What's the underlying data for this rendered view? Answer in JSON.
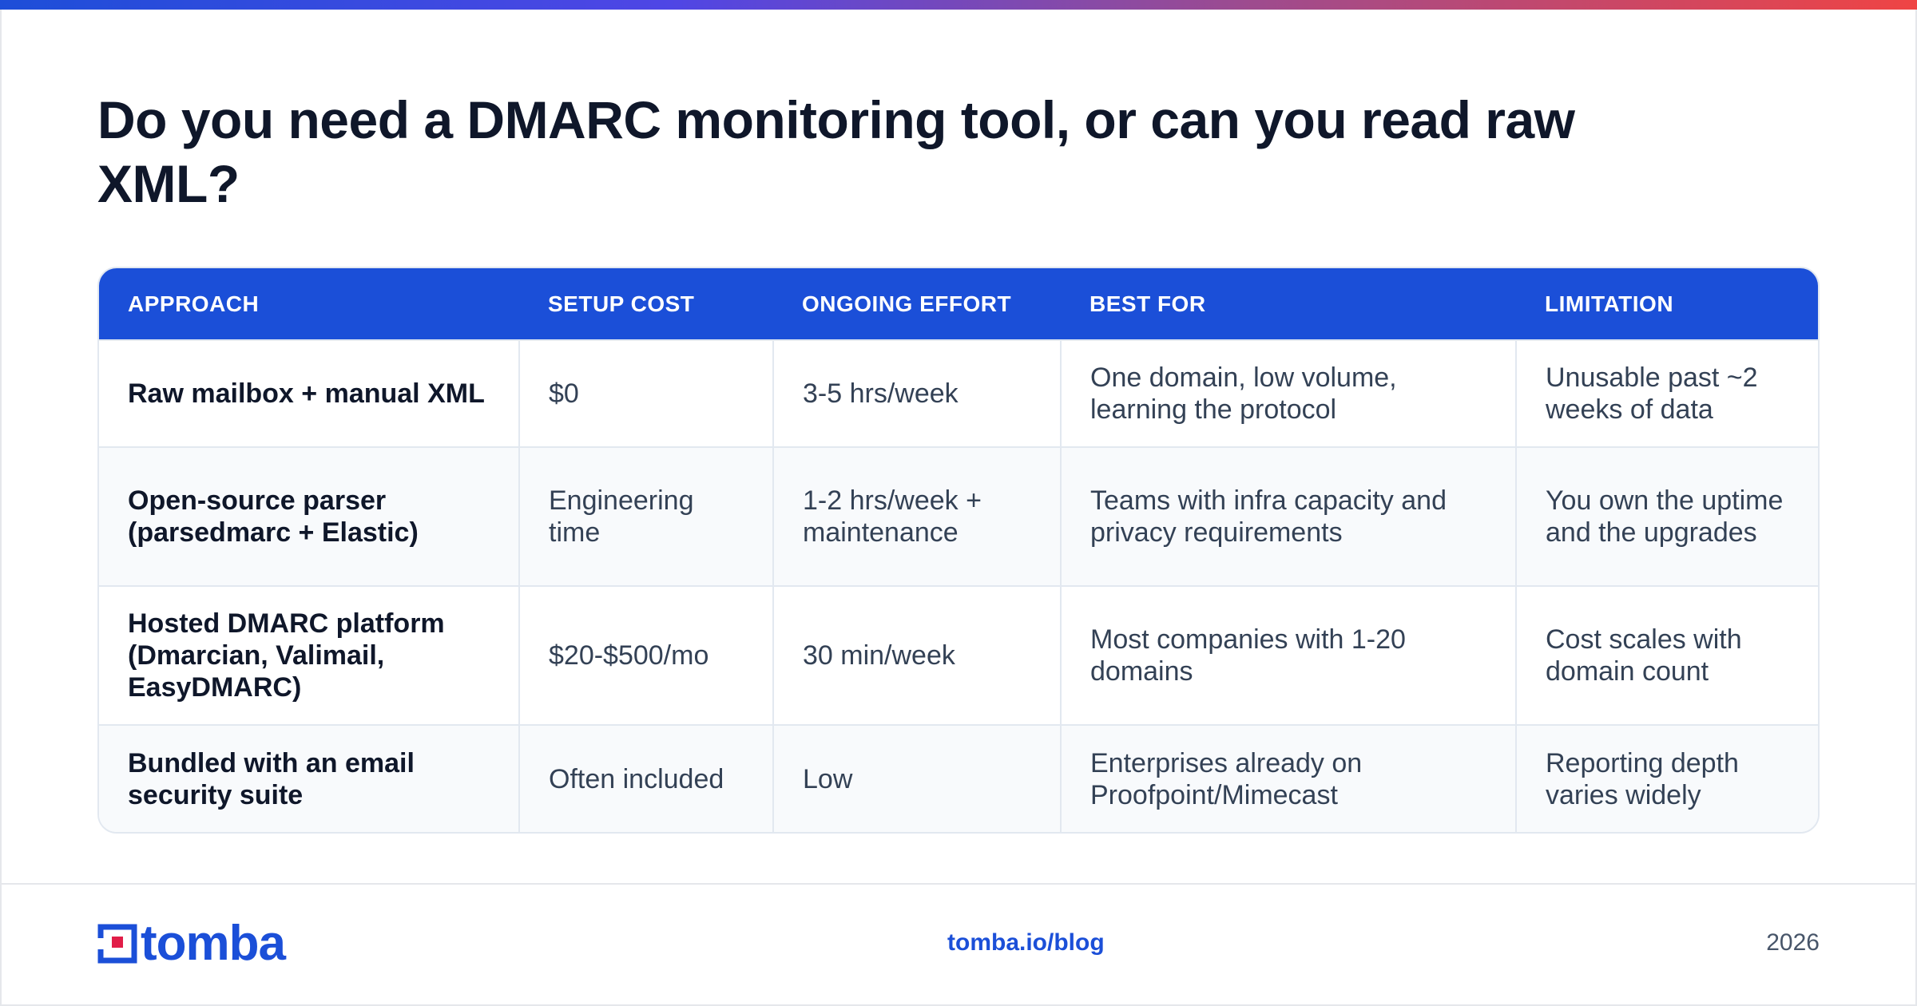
{
  "title": "Do you need a DMARC monitoring tool, or can you read raw XML?",
  "table": {
    "headers": [
      "APPROACH",
      "SETUP COST",
      "ONGOING EFFORT",
      "BEST FOR",
      "LIMITATION"
    ],
    "rows": [
      [
        "Raw mailbox + manual XML",
        "$0",
        "3-5 hrs/week",
        "One domain, low volume, learning the protocol",
        "Unusable past ~2 weeks of data"
      ],
      [
        "Open-source parser (parsedmarc + Elastic)",
        "Engineering time",
        "1-2 hrs/week + maintenance",
        "Teams with infra capacity and privacy requirements",
        "You own the uptime and the upgrades"
      ],
      [
        "Hosted DMARC platform (Dmarcian, Valimail, EasyDMARC)",
        "$20-$500/mo",
        "30 min/week",
        "Most companies with 1-20 domains",
        "Cost scales with domain count"
      ],
      [
        "Bundled with an email security suite",
        "Often included",
        "Low",
        "Enterprises already on Proofpoint/Mimecast",
        "Reporting depth varies widely"
      ]
    ]
  },
  "footer": {
    "logo_text": "tomba",
    "link": "tomba.io/blog",
    "year": "2026"
  },
  "colors": {
    "accent": "#1b4fd8",
    "logo_red": "#e11d48",
    "gradient": [
      "#1d4ed8",
      "#4f46e5",
      "#9d4b8f",
      "#ef4444"
    ]
  },
  "icons": {
    "logo": "tomba-logo-mark-icon"
  }
}
